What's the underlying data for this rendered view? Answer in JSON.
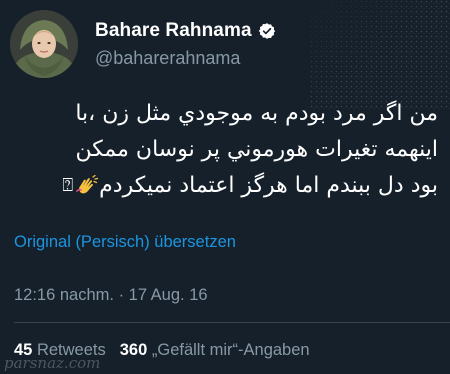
{
  "user": {
    "display_name": "Bahare Rahnama",
    "handle": "@baharerahnama",
    "verified": true,
    "avatar_icon": "profile-photo"
  },
  "tweet": {
    "lines": [
      "من اگر مرد بودم به موجودي مثل زن ،با",
      "اينهمه تغيرات هورموني پر نوسان ممكن",
      "بود دل ببندم اما هرگز اعتماد نميكردم"
    ],
    "emoji_placeholder": "⍰",
    "emoji_icon": "clapping-hands-icon"
  },
  "translate_link": "Original (Persisch) übersetzen",
  "timestamp": "12:16 nachm. · 17 Aug. 16",
  "stats": {
    "retweets_count": "45",
    "retweets_label": "Retweets",
    "likes_count": "360",
    "likes_label": "„Gefällt mir“-Angaben"
  },
  "watermark": "parsnaz.com",
  "colors": {
    "background": "#15202b",
    "link": "#1b95e0",
    "muted": "#8899a6",
    "verified": "#ffffff"
  }
}
